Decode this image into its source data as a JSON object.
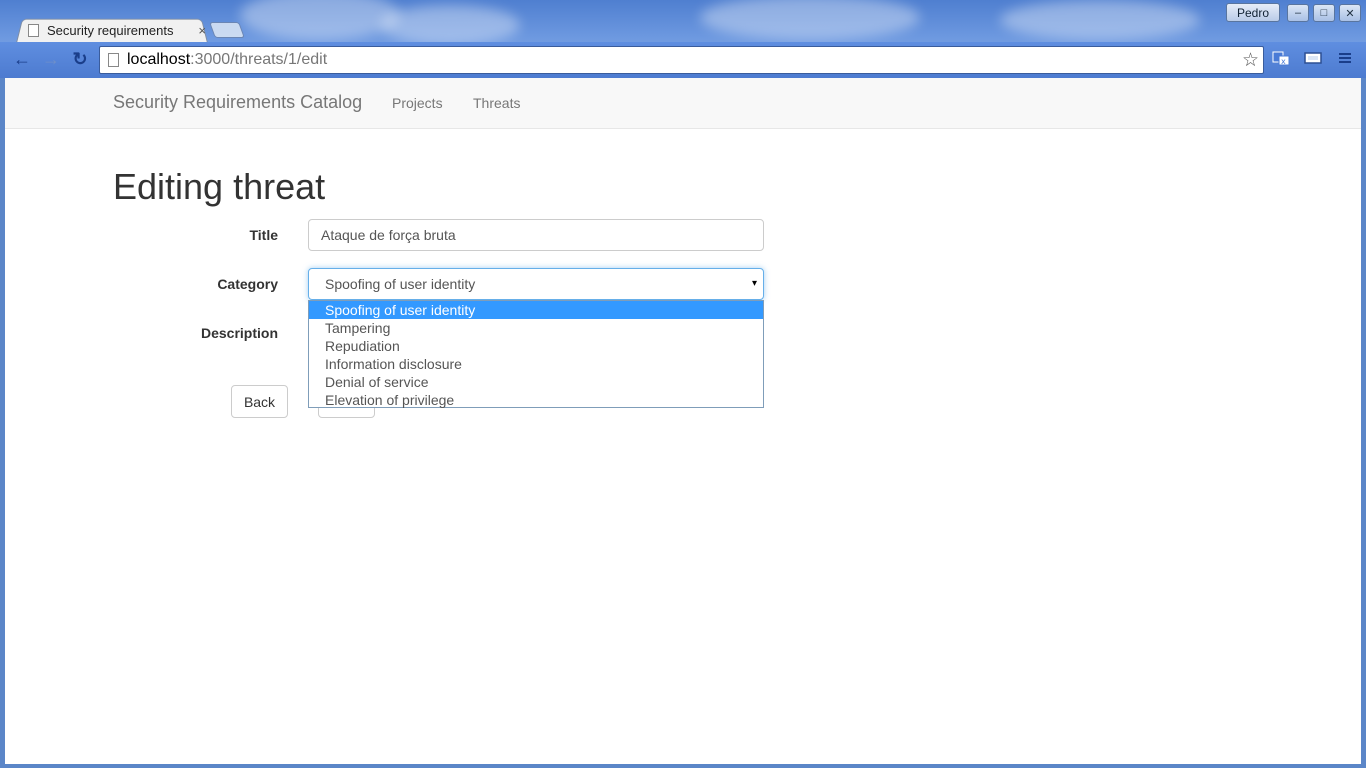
{
  "browser": {
    "tab_title": "Security requirements",
    "tab_close": "×",
    "url_host": "localhost",
    "url_path": ":3000/threats/1/edit",
    "profile": "Pedro",
    "back_glyph": "←",
    "forward_glyph": "→",
    "reload_glyph": "↻",
    "star_glyph": "☆",
    "minimize_glyph": "–",
    "maximize_glyph": "□",
    "close_glyph": "✕"
  },
  "navbar": {
    "brand": "Security Requirements Catalog",
    "links": [
      "Projects",
      "Threats"
    ]
  },
  "page": {
    "title": "Editing threat"
  },
  "form": {
    "title_label": "Title",
    "title_value": "Ataque de força bruta",
    "category_label": "Category",
    "category_value": "Spoofing of user identity",
    "description_label": "Description",
    "category_options": [
      "Spoofing of user identity",
      "Tampering",
      "Repudiation",
      "Information disclosure",
      "Denial of service",
      "Elevation of privilege"
    ],
    "back_label": "Back",
    "caret": "▾"
  },
  "colors": {
    "highlight": "#3399ff",
    "focus_border": "#66afe9",
    "navbar_bg": "#f8f8f8"
  }
}
